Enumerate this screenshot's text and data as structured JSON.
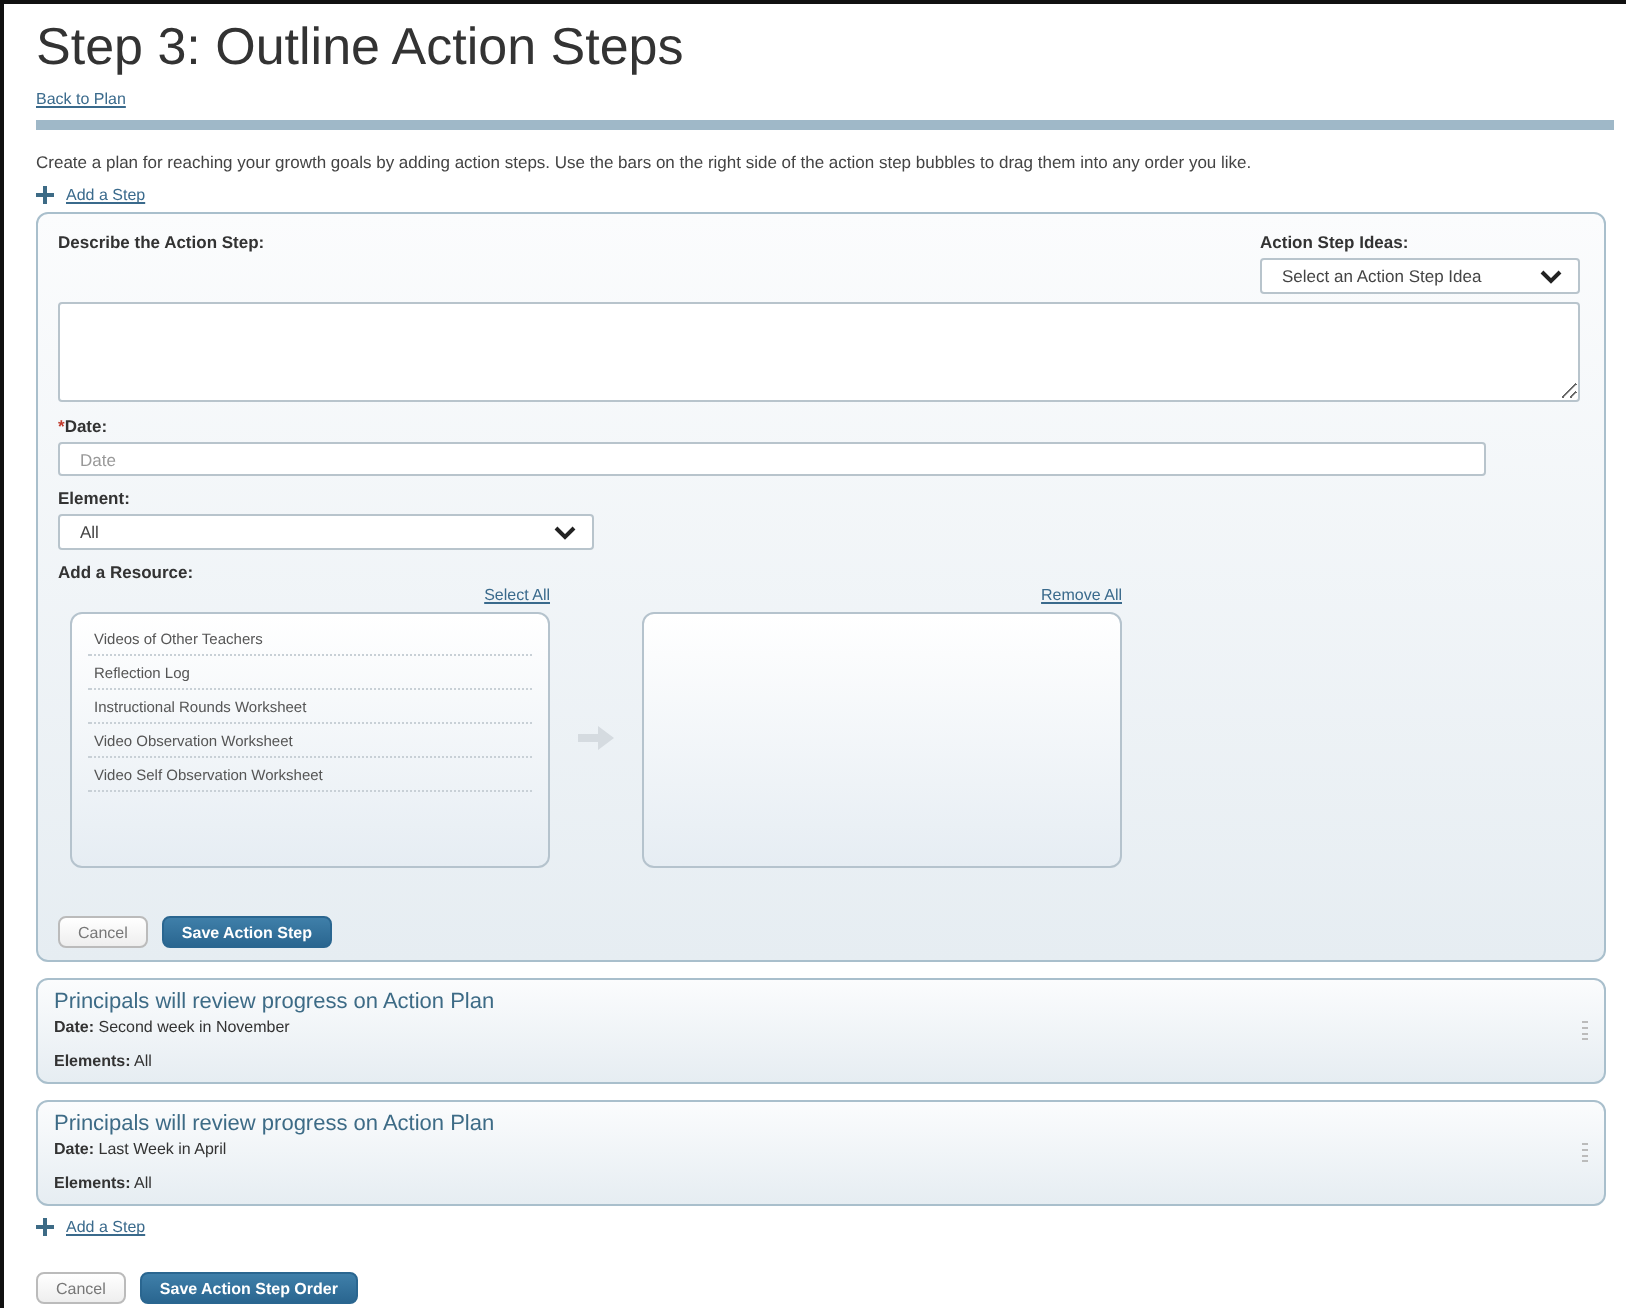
{
  "title": "Step 3: Outline Action Steps",
  "back_link": "Back to Plan",
  "intro": "Create a plan for reaching your growth goals by adding action steps. Use the bars on the right side of the action step bubbles to drag them into any order you like.",
  "add_step_top": "Add a Step",
  "form": {
    "describe_label": "Describe the Action Step:",
    "ideas_label": "Action Step Ideas:",
    "ideas_select": "Select an Action Step Idea",
    "date_required_mark": "*",
    "date_label": "Date:",
    "date_placeholder": "Date",
    "element_label": "Element:",
    "element_select": "All",
    "resource_label": "Add a Resource:",
    "select_all": "Select All",
    "remove_all": "Remove All",
    "available": [
      "Videos of Other Teachers",
      "Reflection Log",
      "Instructional Rounds Worksheet",
      "Video Observation Worksheet",
      "Video Self Observation Worksheet"
    ],
    "cancel": "Cancel",
    "save": "Save Action Step"
  },
  "steps": [
    {
      "title": "Principals will review progress on Action Plan",
      "date": "**Date:** Second week in November",
      "elements": "**Elements:** All"
    },
    {
      "title": "Principals will review progress on Action Plan",
      "date": "**Date:** Last Week in April",
      "elements": "**Elements:** All"
    }
  ],
  "add_step_bottom": "Add a Step",
  "cancel": "Cancel",
  "save_order": "Save Action Step Order"
}
